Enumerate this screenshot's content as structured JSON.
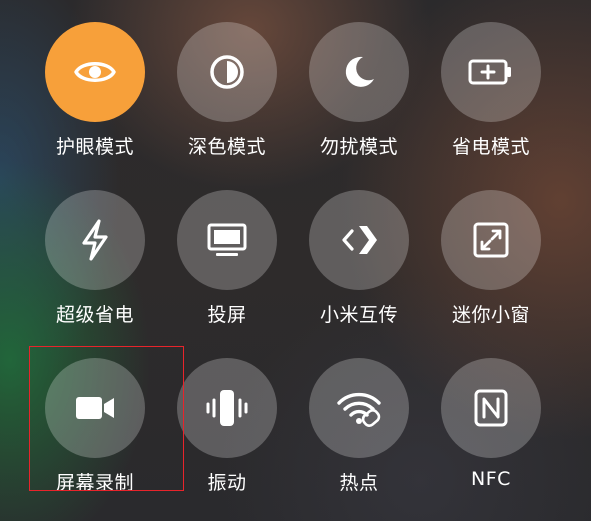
{
  "colors": {
    "active_tile": "#f7a03a",
    "inactive_tile": "rgba(255,255,255,0.24)",
    "label": "#ffffff",
    "highlight_box": "#e8242b"
  },
  "tiles": [
    {
      "label": "护眼模式",
      "icon": "eye-icon",
      "active": true
    },
    {
      "label": "深色模式",
      "icon": "contrast-icon",
      "active": false
    },
    {
      "label": "勿扰模式",
      "icon": "moon-icon",
      "active": false
    },
    {
      "label": "省电模式",
      "icon": "battery-plus-icon",
      "active": false
    },
    {
      "label": "超级省电",
      "icon": "lightning-icon",
      "active": false
    },
    {
      "label": "投屏",
      "icon": "monitor-icon",
      "active": false
    },
    {
      "label": "小米互传",
      "icon": "share-arrow-icon",
      "active": false
    },
    {
      "label": "迷你小窗",
      "icon": "mini-window-icon",
      "active": false
    },
    {
      "label": "屏幕录制",
      "icon": "video-camera-icon",
      "active": false
    },
    {
      "label": "振动",
      "icon": "vibrate-icon",
      "active": false
    },
    {
      "label": "热点",
      "icon": "hotspot-icon",
      "active": false
    },
    {
      "label": "NFC",
      "icon": "nfc-icon",
      "active": false
    }
  ]
}
